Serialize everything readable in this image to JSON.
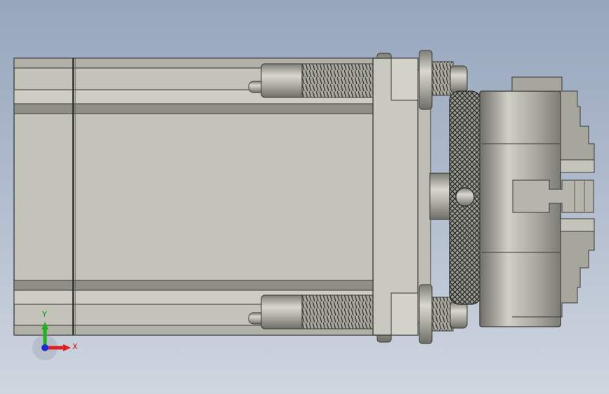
{
  "viewport": {
    "background_top": "#97a6bd",
    "background_bottom": "#cfd6e0"
  },
  "model": {
    "body_color": "#c3c3b9",
    "edge_color": "#3a3a36",
    "metal_color": "#b9b9b0"
  },
  "triad": {
    "x_label": "X",
    "y_label": "Y",
    "x_color": "#e02020",
    "y_color": "#22b022",
    "z_color": "#2030d0"
  }
}
